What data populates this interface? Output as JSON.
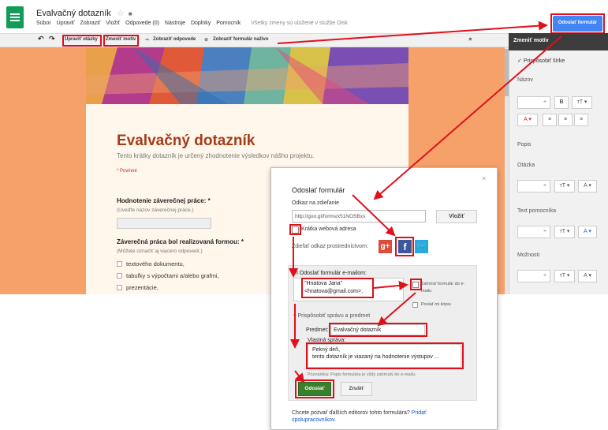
{
  "header": {
    "doc_title": "Evalvačný dotazník",
    "star_glyph": "☆",
    "folder_glyph": "■",
    "menu": [
      "Súbor",
      "Upraviť",
      "Zobraziť",
      "Vložiť",
      "Odpovede (0)",
      "Nástroje",
      "Doplnky",
      "Pomocník"
    ],
    "save_status": "Všetky zmeny sú uložené v službe Disk"
  },
  "toolbar": {
    "undo": "↶",
    "redo": "↷",
    "edit_questions": "Upraviť otázky",
    "change_theme": "Zmeniť motív",
    "view_responses": "Zobraziť odpovede",
    "view_live": "Zobraziť formulár naživo",
    "collapse": "»",
    "send_form": "Odoslať formulár"
  },
  "form": {
    "title": "Evalvačný dotazník",
    "description": "Tento krátky dotazník je určený zhodnotenie výsledkov nášho projektu.",
    "required_note": "* Povinné",
    "q1_title": "Hodnotenie záverečnej práce: *",
    "q1_help": "(Uveďte názov záverečnej práce.)",
    "q2_title": "Záverečná práca bol realizovaná formou: *",
    "q2_help": "(Môžete označiť aj viacero odpovedí.)",
    "q2_options": [
      "textového dokumentu,",
      "tabuľky s výpočtami a/alebo grafmi,",
      "prezentácie,"
    ]
  },
  "theme_panel": {
    "header": "Zmeniť motív",
    "fit_width": "Prispôsobiť šírke",
    "check_glyph": "✓",
    "title_label": "Názov",
    "desc_label": "Popis",
    "question_label": "Otázka",
    "helptext_label": "Text pomocníka",
    "options_label": "Možnosti",
    "spinner": "÷",
    "bold": "B",
    "size": "тT ▾",
    "color": "A ▾",
    "align_left": "≡",
    "align_center": "≡",
    "align_right": "≡"
  },
  "dialog": {
    "title": "Odoslať formulár",
    "close": "×",
    "link_label": "Odkaz na zdieľanie",
    "link_value": "http://goo.gl/forms/x51NOSBxs",
    "insert_button": "Vložiť",
    "short_url_label": "Krátka webová adresa",
    "share_via": "Zdieľať odkaz prostredníctvom:",
    "gplus": "g+",
    "fb": "f",
    "tw": "🐦",
    "email_header": "Odoslať formulár e-mailom:",
    "to_name": "\"Hnatova Jana\"",
    "to_email": "<hnatova@gmail.com>,",
    "include_form": "Zahrnúť formulár do e-mailu",
    "send_copy": "Poslať mi kópiu",
    "customize": "▾ Prispôsobiť správu a predmet",
    "subject_label": "Predmet:",
    "subject_value": "Evalvačný dotazník",
    "message_label": "Vlastná správa:",
    "message_line1": "Pekný deň,",
    "message_line2": "tento dotazník je viazaný na hodnotenie výstupov ...",
    "note": "Poznámka: Popis formulára je vždy zahrnutý do e-mailu.",
    "send_button": "Odoslať",
    "cancel_button": "Zrušiť",
    "invite_text": "Chcete pozvať ďalších editorov tohto formulára? ",
    "invite_link": "Pridať spolupracovníkov."
  },
  "colors": {
    "annotation_red": "#e0101b",
    "brand_green": "#0f9d58",
    "send_blue": "#4285f4",
    "title_rust": "#a33b18"
  }
}
